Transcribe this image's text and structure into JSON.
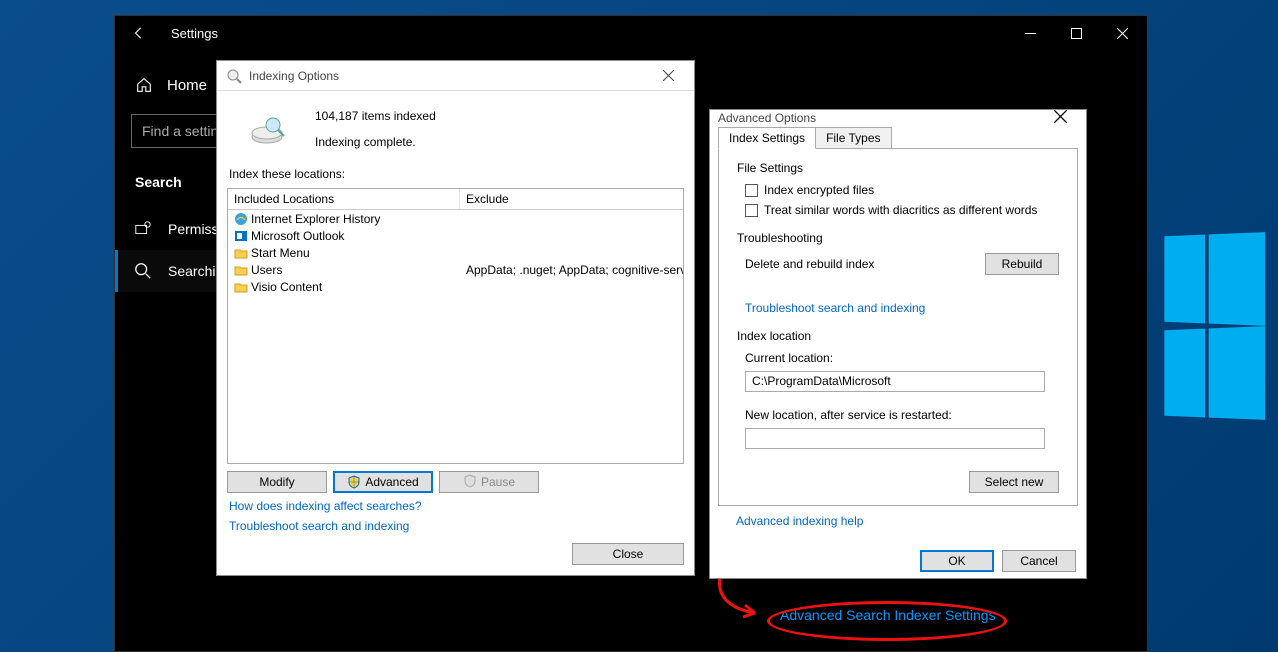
{
  "settings": {
    "title": "Settings",
    "home": "Home",
    "search_placeholder": "Find a setting",
    "section": "Search",
    "nav": {
      "permissions": "Permissions & History",
      "searching": "Searching Windows"
    },
    "adv_link": "Advanced Search Indexer Settings"
  },
  "indexing": {
    "title": "Indexing Options",
    "items_indexed": "104,187 items indexed",
    "status": "Indexing complete.",
    "locations_label": "Index these locations:",
    "col_included": "Included Locations",
    "col_exclude": "Exclude",
    "rows": [
      {
        "name": "Internet Explorer History",
        "exclude": "",
        "icon": "ie"
      },
      {
        "name": "Microsoft Outlook",
        "exclude": "",
        "icon": "outlook"
      },
      {
        "name": "Start Menu",
        "exclude": "",
        "icon": "folder"
      },
      {
        "name": "Users",
        "exclude": "AppData; .nuget; AppData; cognitive-services...",
        "icon": "folder"
      },
      {
        "name": "Visio Content",
        "exclude": "",
        "icon": "folder"
      }
    ],
    "buttons": {
      "modify": "Modify",
      "advanced": "Advanced",
      "pause": "Pause",
      "close": "Close"
    },
    "links": {
      "how": "How does indexing affect searches?",
      "troubleshoot": "Troubleshoot search and indexing"
    }
  },
  "advanced": {
    "title": "Advanced Options",
    "tabs": {
      "index": "Index Settings",
      "filetypes": "File Types"
    },
    "file_settings": {
      "title": "File Settings",
      "encrypted": "Index encrypted files",
      "diacritics": "Treat similar words with diacritics as different words"
    },
    "troubleshooting": {
      "title": "Troubleshooting",
      "rebuild_label": "Delete and rebuild index",
      "rebuild_btn": "Rebuild",
      "link": "Troubleshoot search and indexing"
    },
    "index_location": {
      "title": "Index location",
      "current_label": "Current location:",
      "current_value": "C:\\ProgramData\\Microsoft",
      "new_label": "New location, after service is restarted:",
      "new_value": "",
      "select_new": "Select new"
    },
    "help_link": "Advanced indexing help",
    "buttons": {
      "ok": "OK",
      "cancel": "Cancel"
    }
  }
}
